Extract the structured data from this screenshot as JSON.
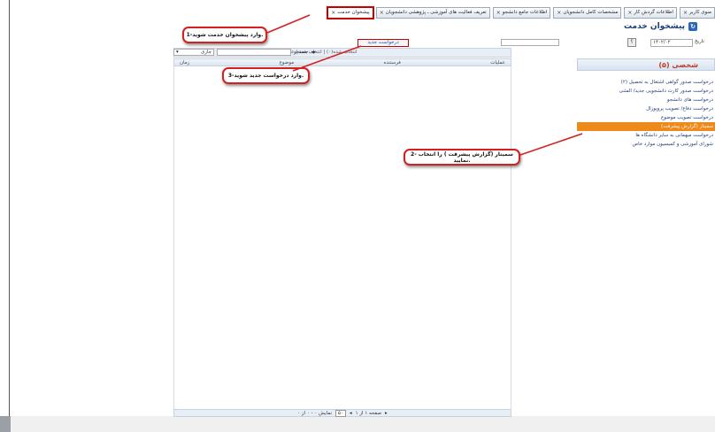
{
  "tabs": [
    {
      "label": "منوی کاربر"
    },
    {
      "label": "اطلاعات گردش کار"
    },
    {
      "label": "مشخصات کامل دانشجویان"
    },
    {
      "label": "اطلاعات جامع دانشجو"
    },
    {
      "label": "تعریف فعالیت های آموزشی ـ پژوهشی دانشجویان"
    },
    {
      "label": "پیشخوان خدمت"
    }
  ],
  "service": {
    "title": "پیشخوان خدمت"
  },
  "filters": {
    "date_label": "تاریخ",
    "date_value": "۱۴۰۲/۰۲",
    "help": "؟"
  },
  "new_request": "درخواست جدید",
  "toolbar": {
    "filter_text": "انتخاب شده(۰) | انتخاب همه | عدم انتخاب",
    "search_label": "جستجو",
    "status_value": "جاری"
  },
  "grid": {
    "columns": [
      "عملیات",
      "فرستنده",
      "موضوع",
      "زمان"
    ]
  },
  "pager": {
    "label": "صفحه ۱ از ۱",
    "show_label": "نمایش ۰ - ۰ از ۰",
    "size": "۵۰"
  },
  "sidebar": {
    "title": "شخصی (۵)",
    "items": [
      "درخواست صدور گواهی اشتغال به تحصیل (۲)",
      "درخواست صدور کارت دانشجویی جدید/ المثنی",
      "درخواست های دانشجو",
      "درخواست دفاع/ تصویب پروپوزال",
      "درخواست تصویب موضوع",
      "سمینار (گزارش پیشرفت)",
      "درخواست میهمانی به سایر دانشگاه ها",
      "شورای آموزشی و کمیسیون موارد خاص"
    ]
  },
  "callouts": {
    "step1": "1-وارد پیشخوان خدمت شوید.",
    "step2": "2- سمینار (گزارش پیشرفت ) را انتخاب نمایید.",
    "step3": "3-وارد درخواست جدید شوید."
  },
  "colors": {
    "callout_border": "#d32020",
    "sidebar_active": "#ee8a1c",
    "accent": "#1b3f77"
  }
}
